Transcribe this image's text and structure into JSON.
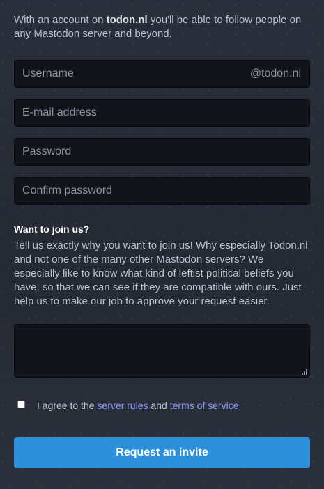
{
  "intro": {
    "prefix": "With an account on ",
    "domain": "todon.nl",
    "suffix": " you'll be able to follow people on any Mastodon server and beyond."
  },
  "fields": {
    "username": {
      "placeholder": "Username",
      "suffix": "@todon.nl",
      "value": ""
    },
    "email": {
      "placeholder": "E-mail address",
      "value": ""
    },
    "password": {
      "placeholder": "Password",
      "value": ""
    },
    "confirm_password": {
      "placeholder": "Confirm password",
      "value": ""
    }
  },
  "reason": {
    "title": "Want to join us?",
    "hint": "Tell us exactly why you want to join us! Why especially Todon.nl and not one of the many other Mastodon servers? We especially like to know what kind of leftist political beliefs you have, so that we can see if they are compatible with ours. Just help us to make our job to approve your request easier.",
    "value": ""
  },
  "agreement": {
    "checked": false,
    "prefix": "I agree to the ",
    "rules_link": "server rules",
    "middle": " and ",
    "terms_link": "terms of service"
  },
  "submit": {
    "label": "Request an invite"
  },
  "colors": {
    "background": "#282c37",
    "input_background": "#131419",
    "button": "#2b90d9",
    "link": "#8c99ff",
    "text": "#b8c2d0"
  }
}
